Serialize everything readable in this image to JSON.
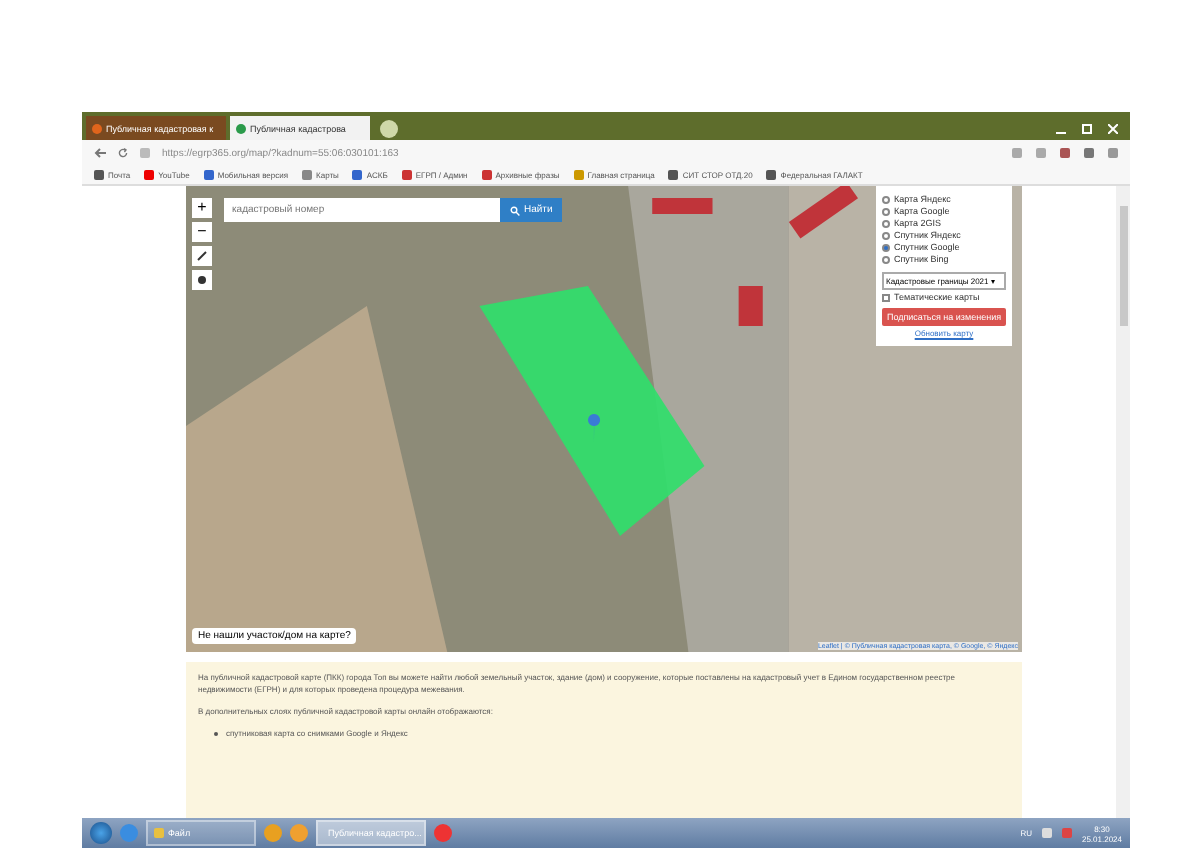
{
  "browser": {
    "tabs": [
      {
        "label": "Публичная кадастровая к",
        "selected": false
      },
      {
        "label": "Публичная кадастрова",
        "selected": true
      }
    ],
    "url": "https://egrp365.org/map/?kadnum=55:06:030101:163",
    "bookmarks": [
      "Почта",
      "YouTube",
      "Мобильная версия",
      "Карты",
      "АСКБ",
      "ЕГРП / Админ",
      "Архивные фразы",
      "Главная страница",
      "СИТ СТОР ОТД.20",
      "Федеральная ГАЛАКТ"
    ]
  },
  "map": {
    "search": {
      "placeholder": "кадастровый номер"
    },
    "search_button": "Найти",
    "zoom_in": "+",
    "zoom_out": "−",
    "layers": [
      {
        "label": "Карта Яндекс",
        "selected": false
      },
      {
        "label": "Карта Google",
        "selected": false
      },
      {
        "label": "Карта 2GIS",
        "selected": false
      },
      {
        "label": "Спутник Яндекс",
        "selected": false
      },
      {
        "label": "Спутник Google",
        "selected": true
      },
      {
        "label": "Спутник Bing",
        "selected": false
      }
    ],
    "boundaries_select": "Кадастровые границы 2021 ▾",
    "thematic": {
      "label": "Тематические карты",
      "checked": false
    },
    "subscribe_button": "Подписаться на изменения",
    "refresh_link": "Обновить карту",
    "not_found_button": "Не нашли участок/дом на карте?",
    "attribution": "Leaflet | © Публичная кадастровая карта, © Google, © Яндекс"
  },
  "content": {
    "paragraph": "На публичной кадастровой карте (ПКК) города Топ вы можете найти любой земельный участок, здание (дом) и сооружение, которые поставлены на кадастровый учет в Едином государственном реестре недвижимости (ЕГРН) и для которых проведена процедура межевания.",
    "layers_intro": "В дополнительных слоях публичной кадастровой карты онлайн отображаются:",
    "bullets": [
      "спутниковая карта со снимками Google и Яндекс"
    ]
  },
  "taskbar": {
    "items": [
      {
        "label": "Файл",
        "selected": false
      },
      {
        "label": "Публичная кадастро...",
        "selected": true
      }
    ],
    "language": "RU",
    "time": "8:30",
    "date": "25.01.2024"
  }
}
